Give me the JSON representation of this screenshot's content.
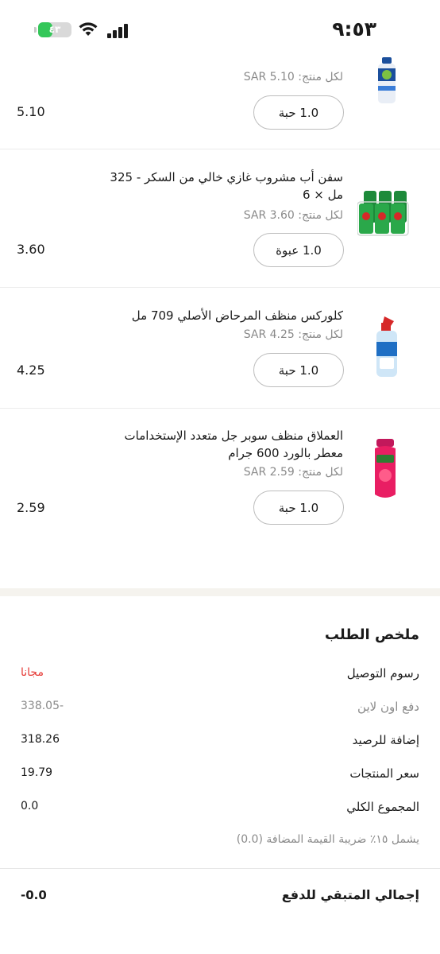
{
  "status_bar": {
    "time": "٩:٥٣",
    "battery": "٤٣",
    "battery_level": 0.43
  },
  "products": [
    {
      "name": "",
      "unit_price": "لكل منتج: SAR 5.10",
      "quantity": "1.0 حبة",
      "total": "5.10",
      "image_icon": "cleaner-spray-bottle-icon"
    },
    {
      "name": "سفن أب مشروب غازي خالي من السكر - 325 مل × 6",
      "unit_price": "لكل منتج: SAR 3.60",
      "quantity": "1.0 عبوة",
      "total": "3.60",
      "image_icon": "soda-can-pack-icon"
    },
    {
      "name": "كلوركس منظف المرحاض الأصلي 709 مل",
      "unit_price": "لكل منتج: SAR 4.25",
      "quantity": "1.0 حبة",
      "total": "4.25",
      "image_icon": "toilet-cleaner-bottle-icon"
    },
    {
      "name": "العملاق منظف سوبر جل متعدد الإستخدامات معطر بالورد 600 جرام",
      "unit_price": "لكل منتج: SAR 2.59",
      "quantity": "1.0 حبة",
      "total": "2.59",
      "image_icon": "gel-cleaner-bottle-icon"
    }
  ],
  "summary": {
    "title": "ملخص الطلب",
    "rows": [
      {
        "label": "رسوم التوصيل",
        "value": "مجانا"
      },
      {
        "label": "دفع اون لاين",
        "value": "338.05-"
      },
      {
        "label": "إضافة للرصيد",
        "value": "318.26"
      },
      {
        "label": "سعر المنتجات",
        "value": "19.79"
      },
      {
        "label": "المجموع الكلي",
        "value": "0.0"
      }
    ],
    "vat_note": "يشمل ١٥٪ ضريبة القيمة المضافة (0.0)",
    "grand_total_label": "إجمالي المتبقي للدفع",
    "grand_total_value": "-0.0"
  },
  "colors": {
    "accent_free": "#e53935",
    "battery_green": "#34c759",
    "muted_text": "#8a8a8a"
  }
}
